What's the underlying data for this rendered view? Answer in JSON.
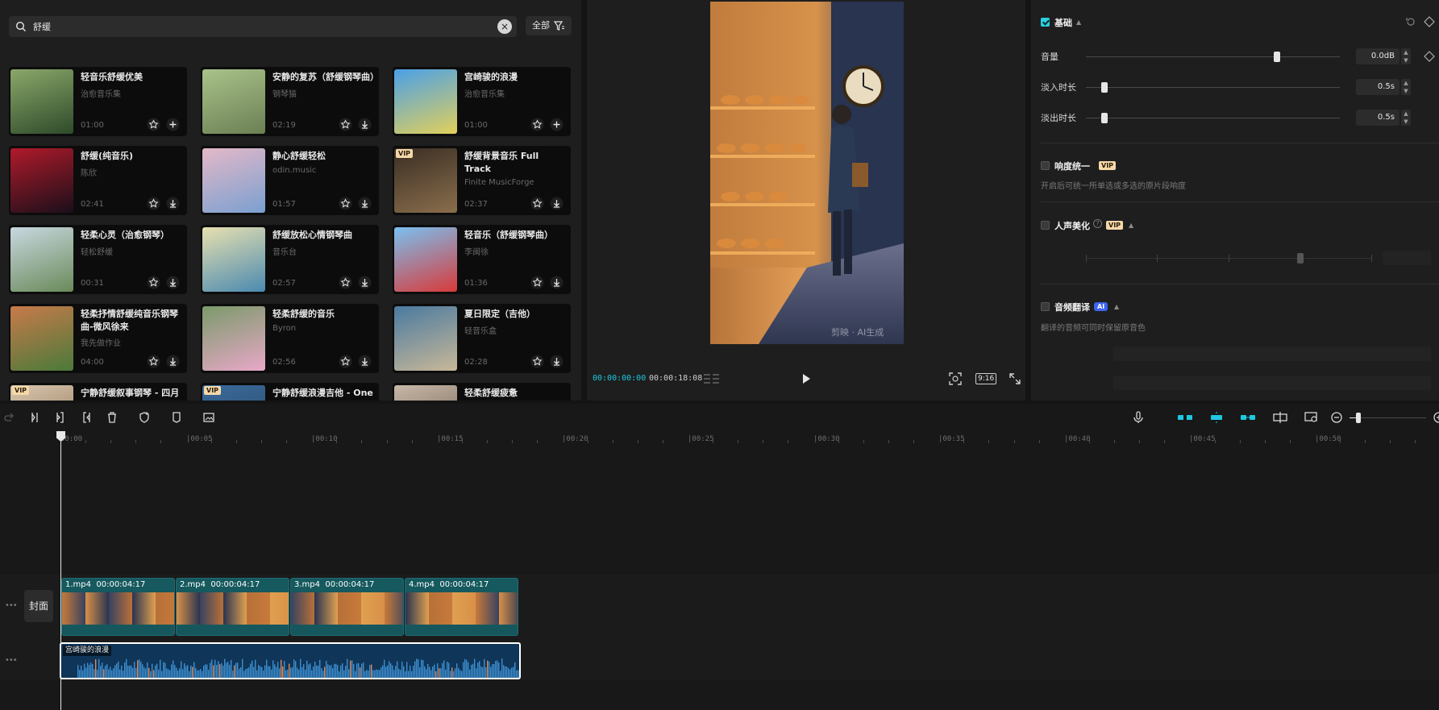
{
  "search": {
    "value": "舒缓",
    "clear_label": "×"
  },
  "filter": {
    "label": "全部"
  },
  "library": {
    "cards": [
      {
        "title": "轻音乐舒缓优美",
        "artist": "治愈音乐集",
        "duration": "01:00",
        "action": "add",
        "vip": false
      },
      {
        "title": "安静的复苏（舒缓钢琴曲）",
        "artist": "钢琴猫",
        "duration": "02:19",
        "action": "download",
        "vip": false
      },
      {
        "title": "宫崎骏的浪漫",
        "artist": "治愈音乐集",
        "duration": "01:00",
        "action": "add",
        "vip": false
      },
      {
        "title": "舒缓(纯音乐)",
        "artist": "陈欣",
        "duration": "02:41",
        "action": "download",
        "vip": false
      },
      {
        "title": "静心舒缓轻松",
        "artist": "odin.music",
        "duration": "01:57",
        "action": "download",
        "vip": false
      },
      {
        "title": "舒缓背景音乐 Full Track",
        "artist": "Finite MusicForge",
        "duration": "02:37",
        "action": "download",
        "vip": true
      },
      {
        "title": "轻柔心灵（治愈钢琴）",
        "artist": "轻松舒缓",
        "duration": "00:31",
        "action": "download",
        "vip": false
      },
      {
        "title": "舒缓放松心情钢琴曲",
        "artist": "音乐台",
        "duration": "02:57",
        "action": "download",
        "vip": false
      },
      {
        "title": "轻音乐（舒缓钢琴曲）",
        "artist": "李闽徐",
        "duration": "01:36",
        "action": "download",
        "vip": false
      },
      {
        "title": "轻柔抒情舒缓纯音乐钢琴曲-微风徐来",
        "artist": "我先做作业",
        "duration": "04:00",
        "action": "download",
        "vip": false
      },
      {
        "title": "轻柔舒缓的音乐",
        "artist": "Byron",
        "duration": "02:56",
        "action": "download",
        "vip": false
      },
      {
        "title": "夏日限定（吉他）",
        "artist": "轻音乐盒",
        "duration": "02:28",
        "action": "download",
        "vip": false
      },
      {
        "title": "宁静舒缓叙事钢琴 - 四月",
        "artist": "",
        "duration": "",
        "action": "",
        "vip": true
      },
      {
        "title": "宁静舒缓浪漫吉他 - One",
        "artist": "",
        "duration": "",
        "action": "",
        "vip": true
      },
      {
        "title": "轻柔舒缓疲惫",
        "artist": "",
        "duration": "",
        "action": "",
        "vip": false
      }
    ]
  },
  "preview": {
    "watermark": "剪映 · AI生成",
    "current_time": "00:00:00:00",
    "total_time": "00:00:18:08",
    "ratio": "9:16"
  },
  "props": {
    "basic": {
      "title": "基础",
      "checked": true
    },
    "volume": {
      "label": "音量",
      "value": "0.0dB",
      "level": 0.74
    },
    "fade_in": {
      "label": "淡入时长",
      "value": "0.5s",
      "level": 0.06
    },
    "fade_out": {
      "label": "淡出时长",
      "value": "0.5s",
      "level": 0.06
    },
    "loudness": {
      "title": "响度统一",
      "hint": "开启后可统一所单选或多选的原片段响度",
      "badge": "VIP"
    },
    "voice": {
      "title": "人声美化",
      "badge": "VIP",
      "help": "?"
    },
    "translate": {
      "title": "音频翻译",
      "badge": "AI",
      "hint": "翻译的音频可同时保留原音色"
    }
  },
  "timeline": {
    "ruler": [
      "00:00",
      "|00:05",
      "|00:10",
      "|00:15",
      "|00:20",
      "|00:25",
      "|00:30",
      "|00:35",
      "|00:40",
      "|00:45",
      "|00:50"
    ],
    "cover_label": "封面",
    "clips": [
      {
        "name": "1.mp4",
        "duration": "00:00:04:17"
      },
      {
        "name": "2.mp4",
        "duration": "00:00:04:17"
      },
      {
        "name": "3.mp4",
        "duration": "00:00:04:17"
      },
      {
        "name": "4.mp4",
        "duration": "00:00:04:17"
      }
    ],
    "audio_clip": {
      "name": "宫崎骏的浪漫"
    }
  },
  "colors": {
    "accent": "#1ec8e0",
    "clip": "#16595e",
    "audio": "#0f3558",
    "vip": "#f5d8a8"
  }
}
